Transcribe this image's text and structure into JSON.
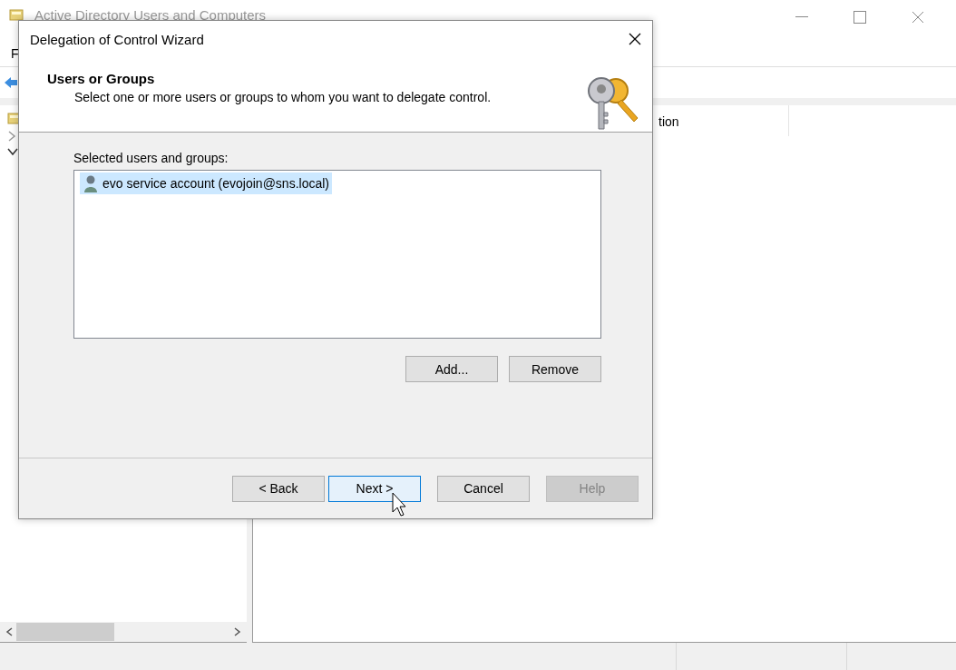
{
  "background_window": {
    "title": "Active Directory Users and Computers",
    "menu": [
      "F"
    ],
    "column_header": "tion"
  },
  "dialog": {
    "title": "Delegation of Control Wizard",
    "heading": "Users or Groups",
    "subheading": "Select one or more users or groups to whom you want to delegate control.",
    "list_label": "Selected users and groups:",
    "items": [
      {
        "label": "evo service account (evojoin@sns.local)",
        "selected": true
      }
    ],
    "list_buttons": [
      {
        "label": "Add..."
      },
      {
        "label": "Remove"
      }
    ],
    "buttons": [
      {
        "label": "< Back",
        "focused": false,
        "disabled": false
      },
      {
        "label": "Next >",
        "focused": true,
        "disabled": false
      },
      {
        "label": "Cancel",
        "focused": false,
        "disabled": false
      },
      {
        "label": "Help",
        "focused": false,
        "disabled": true
      }
    ]
  }
}
